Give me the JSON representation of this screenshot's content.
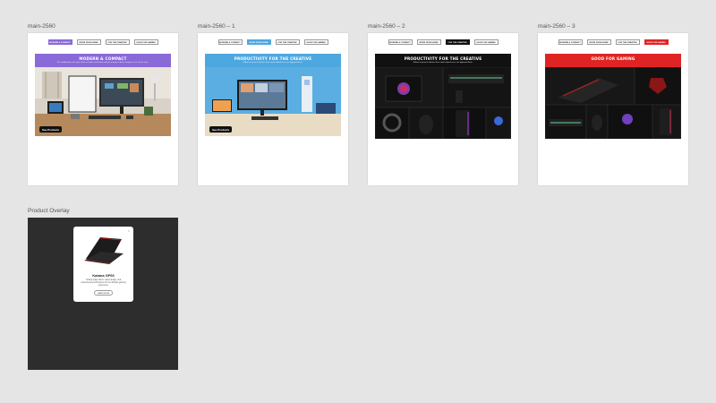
{
  "artboards": [
    {
      "label": "main-2560",
      "accent": "#8a6ad8",
      "hero_title": "MODERN & COMPACT",
      "hero_sub": "Wer no Adendrum mit uniqui. Gnom at cellent, sed rudens notwest, sivaryp eu deuor, vinstaga, nu ue, unt ext sivius.",
      "cta": "See Products",
      "active_tab": 0
    },
    {
      "label": "main-2560 – 1",
      "accent": "#4ea8e0",
      "hero_title": "PRODUCTIVITY FOR THE CREATIVE",
      "hero_sub": "Nullam at ipsum id ultricies. Nunc vitae hendrerit arcu, nec dignissim libero.",
      "cta": "See Products",
      "active_tab": 1
    },
    {
      "label": "main-2560 – 2",
      "accent": "#111111",
      "hero_title": "PRODUCTIVITY FOR THE CREATIVE",
      "hero_sub": "Nullam at ipsum id ultricies. Nunc vitae hendrerit arcu, nec dignissim libero.",
      "active_tab": 2
    },
    {
      "label": "main-2560 – 3",
      "accent": "#e02424",
      "hero_title": "GOOD FOR GAMING",
      "hero_sub": "",
      "active_tab": 3
    }
  ],
  "tabs": [
    "MODERN & COMPACT",
    "WORK FROM HOME",
    "FOR THE CREATIVE",
    "GOOD FOR GAMING"
  ],
  "overlay": {
    "label": "Product Overlay",
    "close": "×",
    "product_name": "Katana GF66",
    "product_desc": "Cutting-edge silicon, sleek design, and powerhouse performance for the ultimate gaming experience.",
    "button": "LEARN MORE"
  }
}
